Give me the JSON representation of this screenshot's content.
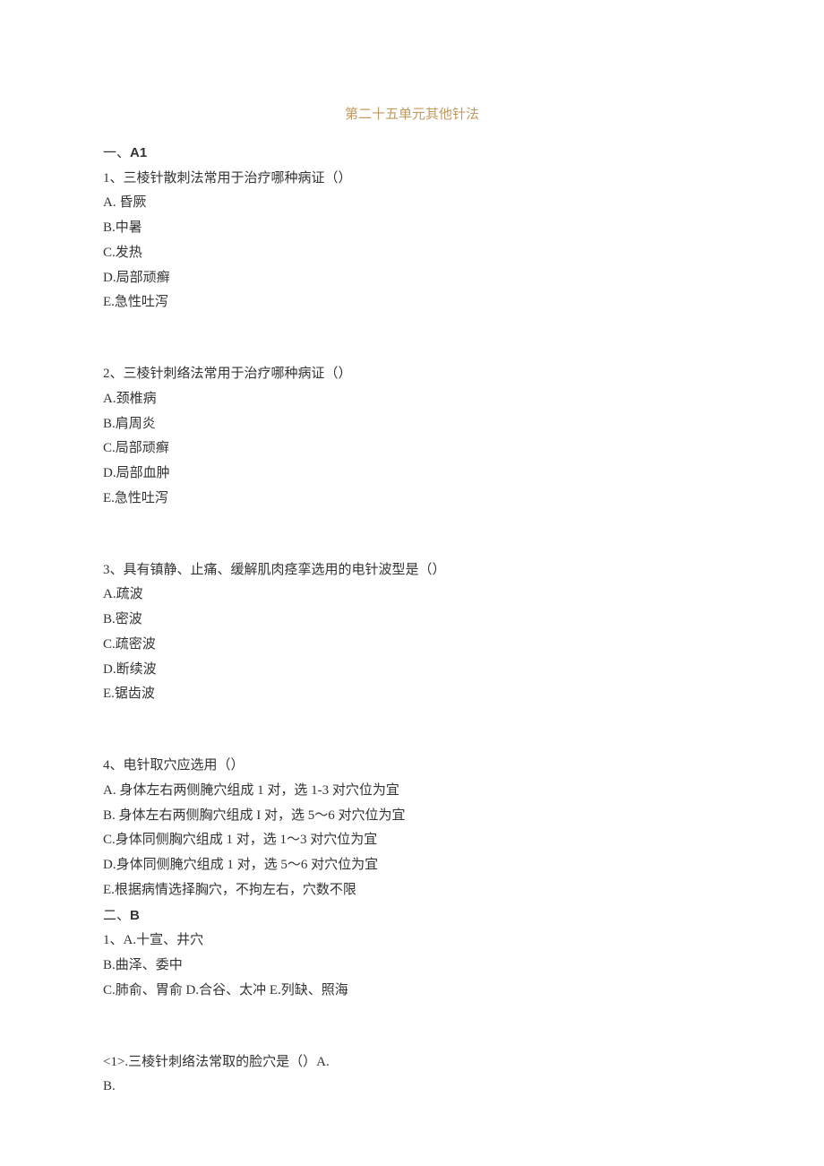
{
  "title": "第二十五单元其他针法",
  "sectionA": {
    "header_prefix": "一、",
    "header_label": "A1",
    "questions": [
      {
        "stem": "1、三棱针散刺法常用于治疗哪种病证（）",
        "options": [
          "A. 昏厥",
          "B.中暑",
          "C.发热",
          "D.局部顽癣",
          "E.急性吐泻"
        ]
      },
      {
        "stem": "2、三棱针刺络法常用于治疗哪种病证（）",
        "options": [
          "A.颈椎病",
          "B.肩周炎",
          "C.局部顽癣",
          "D.局部血肿",
          "E.急性吐泻"
        ]
      },
      {
        "stem": "3、具有镇静、止痛、缓解肌肉痉挛选用的电针波型是（）",
        "options": [
          "A.疏波",
          "B.密波",
          "C.疏密波",
          "D.断续波",
          "E.锯齿波"
        ]
      },
      {
        "stem": "4、电针取穴应选用（）",
        "options": [
          "A. 身体左右两侧腌穴组成 1 对，选 1-3 对穴位为宜",
          "B. 身体左右两侧胸穴组成 I 对，选 5〜6 对穴位为宜",
          "C.身体同侧胸穴组成 1 对，选 1〜3 对穴位为宜",
          "D.身体同侧腌穴组成 1 对，选 5〜6 对穴位为宜",
          "E.根据病情选择胸穴，不拘左右，穴数不限"
        ]
      }
    ]
  },
  "sectionB": {
    "header_prefix": "二、",
    "header_label": "B",
    "shared_options": [
      "1、A.十宣、井穴",
      "B.曲泽、委中",
      "C.肺俞、胃俞 D.合谷、太冲 E.列缺、照海"
    ],
    "sub_questions": [
      "<1>.三棱针刺络法常取的脸穴是（）A.",
      "B."
    ]
  }
}
